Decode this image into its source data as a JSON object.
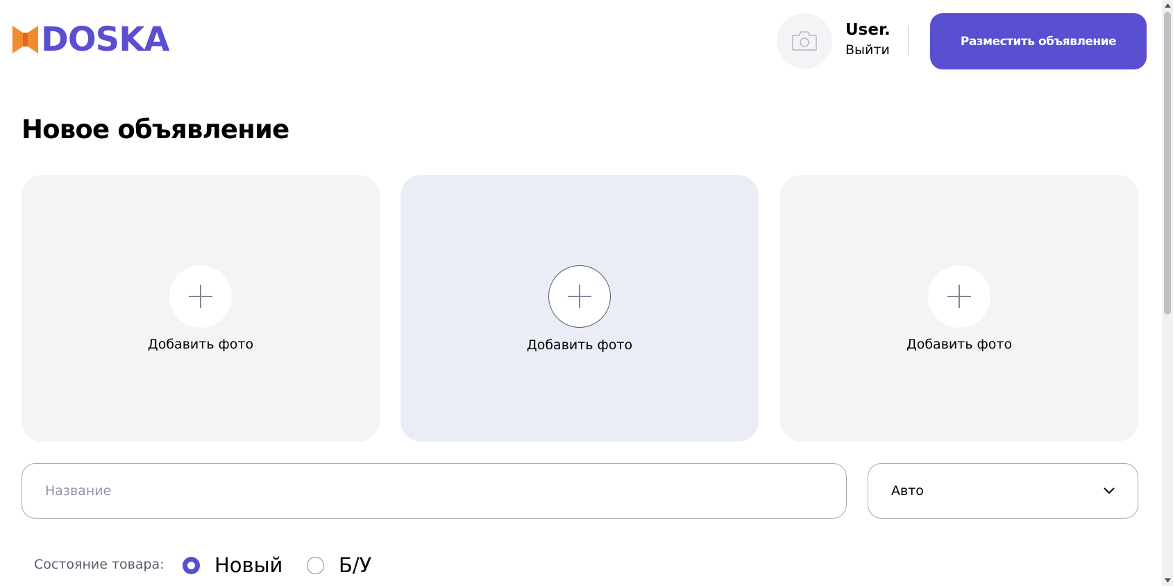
{
  "header": {
    "logo_text": "DOSKA",
    "user_name": "User.",
    "logout_label": "Выйти",
    "post_button_label": "Разместить объявление"
  },
  "page_title": "Новое объявление",
  "photo_slots": [
    {
      "label": "Добавить фото",
      "state": "default"
    },
    {
      "label": "Добавить фото",
      "state": "hover"
    },
    {
      "label": "Добавить фото",
      "state": "default"
    }
  ],
  "form": {
    "title_placeholder": "Название",
    "title_value": "",
    "category_selected": "Авто"
  },
  "condition": {
    "label": "Состояние товара:",
    "options": [
      {
        "label": "Новый",
        "checked": true
      },
      {
        "label": "Б/У",
        "checked": false
      }
    ]
  },
  "icons": {
    "logo": "doska-logo-icon",
    "avatar": "camera-icon",
    "add_photo": "plus-icon",
    "category_dropdown": "chevron-down-icon"
  },
  "colors": {
    "brand": "#5a4fd1",
    "logo_accent": "#f28a2e",
    "slot_background": "#f4f4f6",
    "slot_hover_background": "#eaedf5",
    "muted_text": "#5b5b6e"
  }
}
